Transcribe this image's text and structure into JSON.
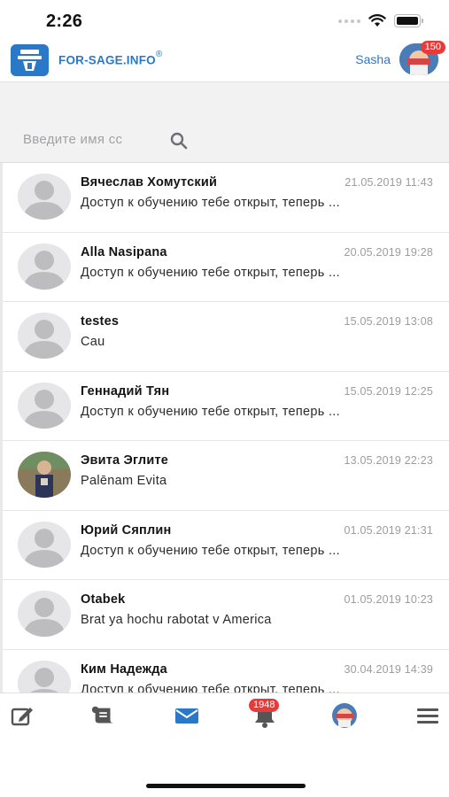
{
  "status_bar": {
    "time": "2:26"
  },
  "header": {
    "brand": "FOR-SAGE.INFO",
    "brand_mark": "®",
    "username": "Sasha",
    "badge": "150"
  },
  "search": {
    "placeholder": "Введите имя сс"
  },
  "conversations": [
    {
      "name": "Вячеслав Хомутский",
      "date": "21.05.2019 11:43",
      "message": "Доступ к обучению тебе открыт, теперь ...",
      "avatar": "default"
    },
    {
      "name": "Alla Nasipana",
      "date": "20.05.2019 19:28",
      "message": "Доступ к обучению тебе открыт, теперь ...",
      "avatar": "default"
    },
    {
      "name": "testes",
      "date": "15.05.2019 13:08",
      "message": "Cau",
      "avatar": "default"
    },
    {
      "name": "Геннадий Тян",
      "date": "15.05.2019 12:25",
      "message": "Доступ к обучению тебе открыт, теперь ...",
      "avatar": "default"
    },
    {
      "name": "Эвита Эглите",
      "date": "13.05.2019 22:23",
      "message": "Palēnam Evita",
      "avatar": "photo"
    },
    {
      "name": "Юрий Сяплин",
      "date": "01.05.2019 21:31",
      "message": "Доступ к обучению тебе открыт, теперь ...",
      "avatar": "default"
    },
    {
      "name": "Otabek",
      "date": "01.05.2019 10:23",
      "message": "Brat ya hochu rabotat v America",
      "avatar": "default"
    },
    {
      "name": "Ким Надежда",
      "date": "30.04.2019 14:39",
      "message": "Доступ к обучению тебе открыт, теперь ...",
      "avatar": "default"
    }
  ],
  "tabbar": {
    "notifications_badge": "1948",
    "icons": [
      "edit-icon",
      "scroll-icon",
      "mail-icon",
      "bell-icon",
      "profile-avatar",
      "menu-icon"
    ],
    "active_color": "#2a79c9"
  },
  "colors": {
    "brand": "#2a79c9",
    "badge": "#e93a3a",
    "muted": "#9c9c9f"
  }
}
